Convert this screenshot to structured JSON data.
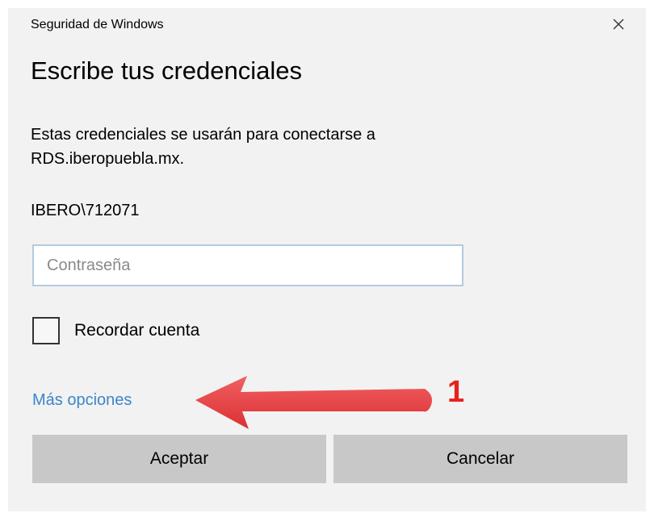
{
  "window": {
    "title": "Seguridad de Windows",
    "close_icon": "close-icon"
  },
  "dialog": {
    "heading": "Escribe tus credenciales",
    "description_line1": "Estas credenciales se usarán para conectarse a",
    "description_line2": "RDS.iberopuebla.mx.",
    "username": "IBERO\\712071",
    "password": {
      "value": "",
      "placeholder": "Contraseña"
    },
    "remember": {
      "label": "Recordar cuenta",
      "checked": false
    },
    "more_options": "Más opciones",
    "buttons": {
      "accept": "Aceptar",
      "cancel": "Cancelar"
    }
  },
  "annotation": {
    "number": "1",
    "color": "#e8201c",
    "arrow_icon": "left-arrow-icon"
  },
  "colors": {
    "background": "#f2f2f2",
    "link": "#3b85c9",
    "button": "#c8c8c8",
    "input_border": "#b3cbe0"
  }
}
